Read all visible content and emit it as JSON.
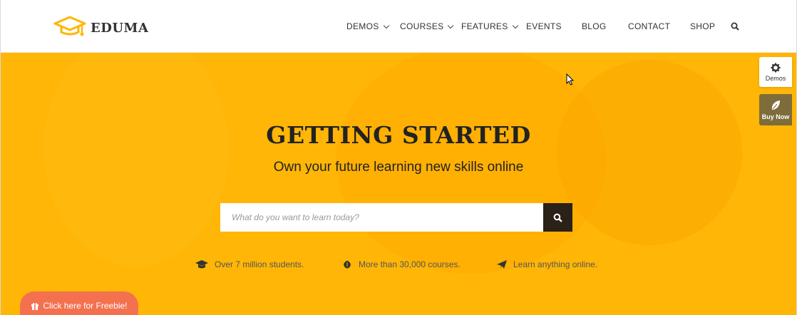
{
  "brand": {
    "name": "EDUMA"
  },
  "nav": {
    "items": [
      {
        "label": "DEMOS",
        "dropdown": true
      },
      {
        "label": "COURSES",
        "dropdown": true
      },
      {
        "label": "FEATURES",
        "dropdown": true
      },
      {
        "label": "EVENTS",
        "dropdown": false
      },
      {
        "label": "BLOG",
        "dropdown": false
      },
      {
        "label": "CONTACT",
        "dropdown": false
      },
      {
        "label": "SHOP",
        "dropdown": false
      }
    ]
  },
  "hero": {
    "title": "GETTING STARTED",
    "subtitle": "Own your future learning new skills online",
    "search": {
      "placeholder": "What do you want to learn today?"
    },
    "stats": [
      {
        "icon": "graduation-cap-icon",
        "text": "Over 7 million students."
      },
      {
        "icon": "rebel-icon",
        "text": "More than 30,000 courses."
      },
      {
        "icon": "paper-plane-icon",
        "text": "Learn anything online."
      }
    ]
  },
  "side": {
    "demos_label": "Demos",
    "buy_label": "Buy Now"
  },
  "freebie": {
    "label": "Click here for Freebie!"
  },
  "colors": {
    "accent": "#ffb606",
    "dark": "#2a2119",
    "freebie": "#f4714f",
    "buy": "#7e6c3b"
  }
}
